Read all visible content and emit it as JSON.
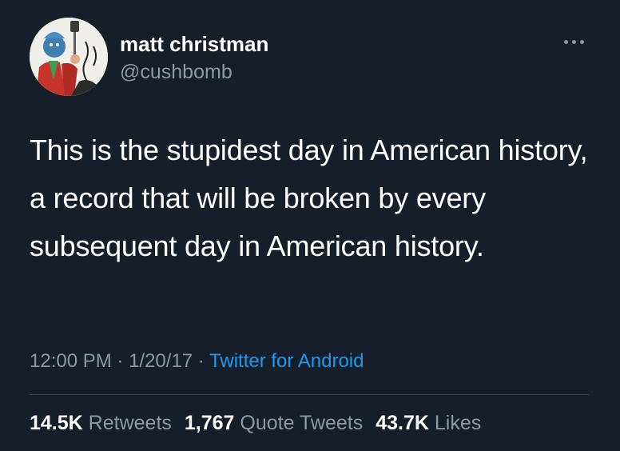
{
  "user": {
    "name": "matt christman",
    "handle": "@cushbomb"
  },
  "tweet": {
    "text": "This is the stupidest day in American history, a record that will be broken by every subsequent day in American history.",
    "time": "12:00 PM",
    "separator": " · ",
    "date": "1/20/17",
    "source": "Twitter for Android"
  },
  "stats": {
    "retweets_count": "14.5K",
    "retweets_label": "Retweets",
    "quotes_count": "1,767",
    "quotes_label": "Quote Tweets",
    "likes_count": "43.7K",
    "likes_label": "Likes"
  },
  "icons": {
    "more": "more-horizontal-icon"
  },
  "colors": {
    "background": "#161e29",
    "secondary_text": "#8b98a5",
    "link": "#1d9bf0",
    "divider": "#38444d"
  }
}
